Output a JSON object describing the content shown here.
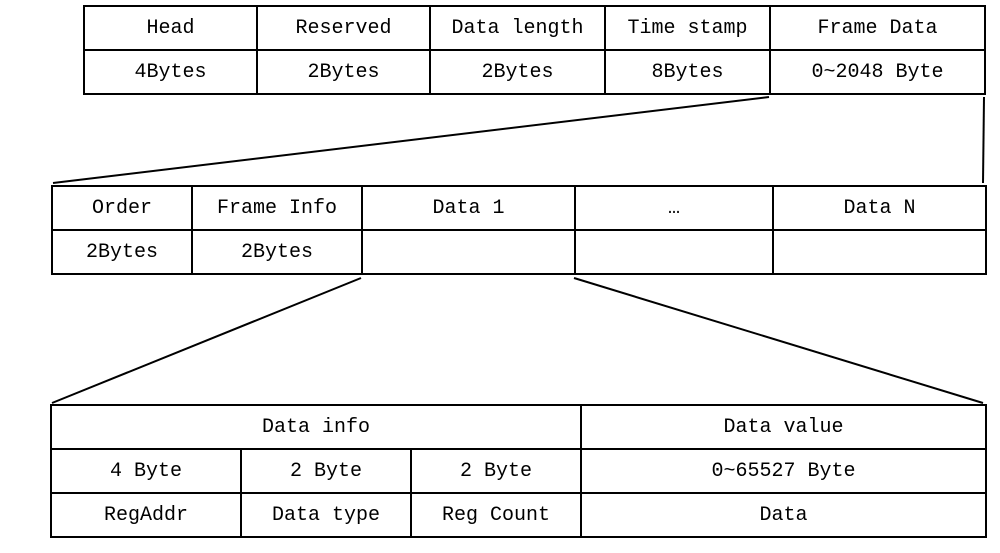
{
  "table1": {
    "headers": [
      "Head",
      "Reserved",
      "Data length",
      "Time stamp",
      "Frame Data"
    ],
    "values": [
      "4Bytes",
      "2Bytes",
      "2Bytes",
      "8Bytes",
      "0~2048 Byte"
    ]
  },
  "table2": {
    "headers": [
      "Order",
      "Frame Info",
      "Data 1",
      "…",
      "Data N"
    ],
    "values": [
      "2Bytes",
      "2Bytes",
      "",
      "",
      ""
    ]
  },
  "table3": {
    "group_headers": [
      "Data info",
      "Data value"
    ],
    "sizes": [
      "4 Byte",
      "2 Byte",
      "2 Byte",
      "0~65527 Byte"
    ],
    "fields": [
      "RegAddr",
      "Data type",
      "Reg Count",
      "Data"
    ]
  }
}
